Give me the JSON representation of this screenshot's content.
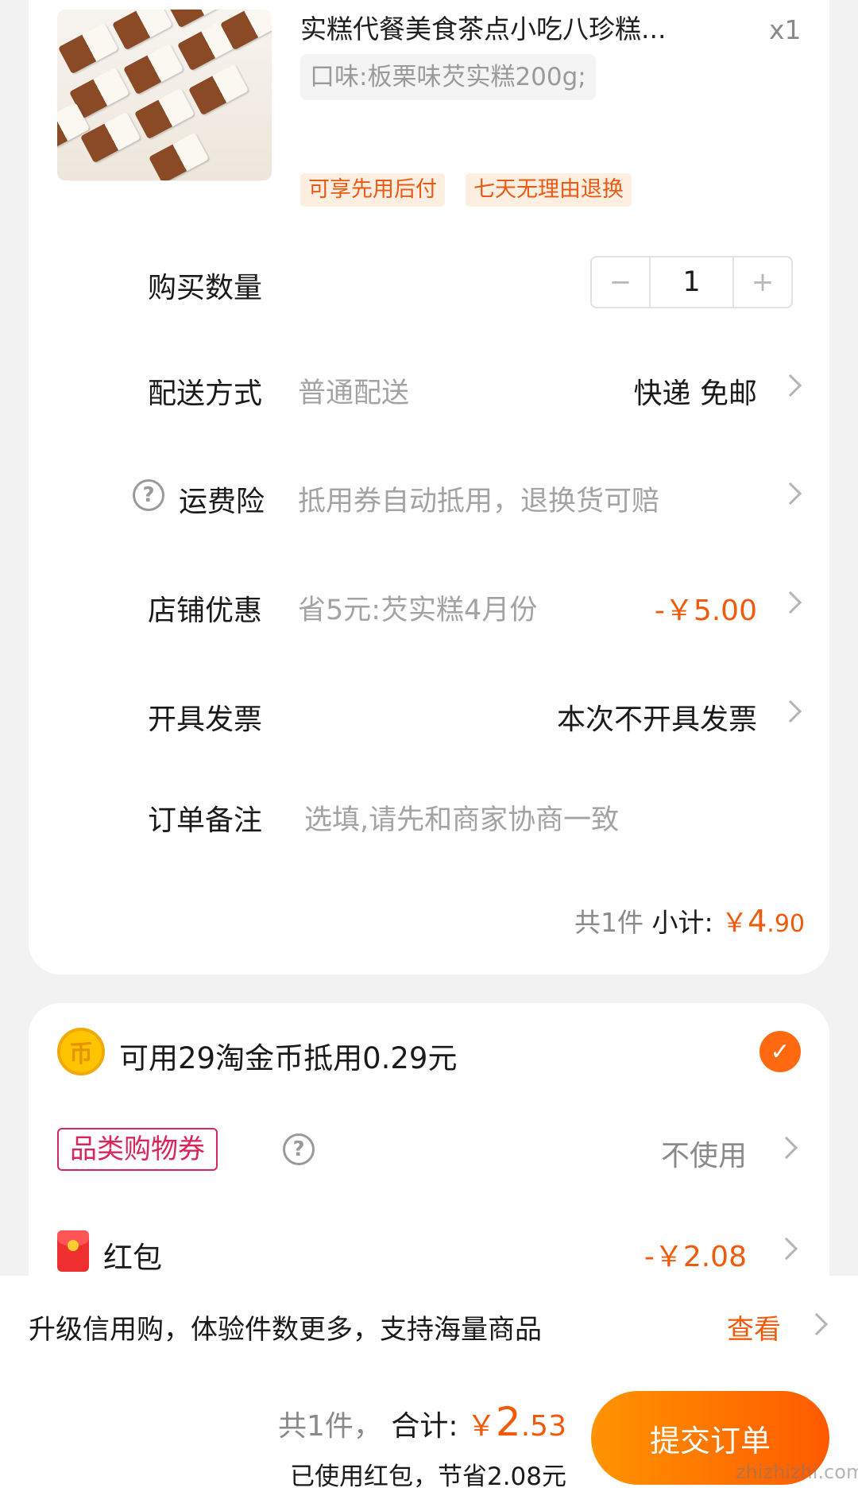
{
  "product": {
    "title": "实糕代餐美食茶点小吃八珍糕...",
    "quantity_label": "x1",
    "spec": "口味:板栗味芡实糕200g;",
    "tags": [
      "可享先用后付",
      "七天无理由退换"
    ]
  },
  "rows": {
    "quantity": {
      "label": "购买数量",
      "value": "1",
      "minus": "−",
      "plus": "+"
    },
    "delivery": {
      "label": "配送方式",
      "sub": "普通配送",
      "value": "快递 免邮"
    },
    "shipping_insurance": {
      "label": "运费险",
      "sub": "抵用券自动抵用，退换货可赔"
    },
    "store_discount": {
      "label": "店铺优惠",
      "sub": "省5元:芡实糕4月份",
      "value": "-￥5.00"
    },
    "invoice": {
      "label": "开具发票",
      "value": "本次不开具发票"
    },
    "note": {
      "label": "订单备注",
      "placeholder": "选填,请先和商家协商一致"
    }
  },
  "subtotal": {
    "count": "共1件",
    "label": "小计:",
    "currency": "￥",
    "amount_main": "4",
    "amount_decimal": ".90"
  },
  "discounts": {
    "coin_text": "可用29淘金币抵用0.29元",
    "coin_icon_text": "币",
    "coupon_label": "品类购物券",
    "coupon_value": "不使用",
    "redpacket_label": "红包",
    "redpacket_value": "-￥2.08"
  },
  "footer": {
    "promo_text": "升级信用购，体验件数更多，支持海量商品",
    "promo_link": "查看",
    "count": "共1件，",
    "total_label": "合计:",
    "currency": "￥",
    "total_main": "2",
    "total_decimal": ".53",
    "saved_text": "已使用红包，节省2.08元",
    "submit_label": "提交订单",
    "watermark": "zhizhizhi.com"
  },
  "colors": {
    "accent": "#f05a0a",
    "coupon": "#d9265a",
    "tag_bg": "#fdeee2"
  }
}
